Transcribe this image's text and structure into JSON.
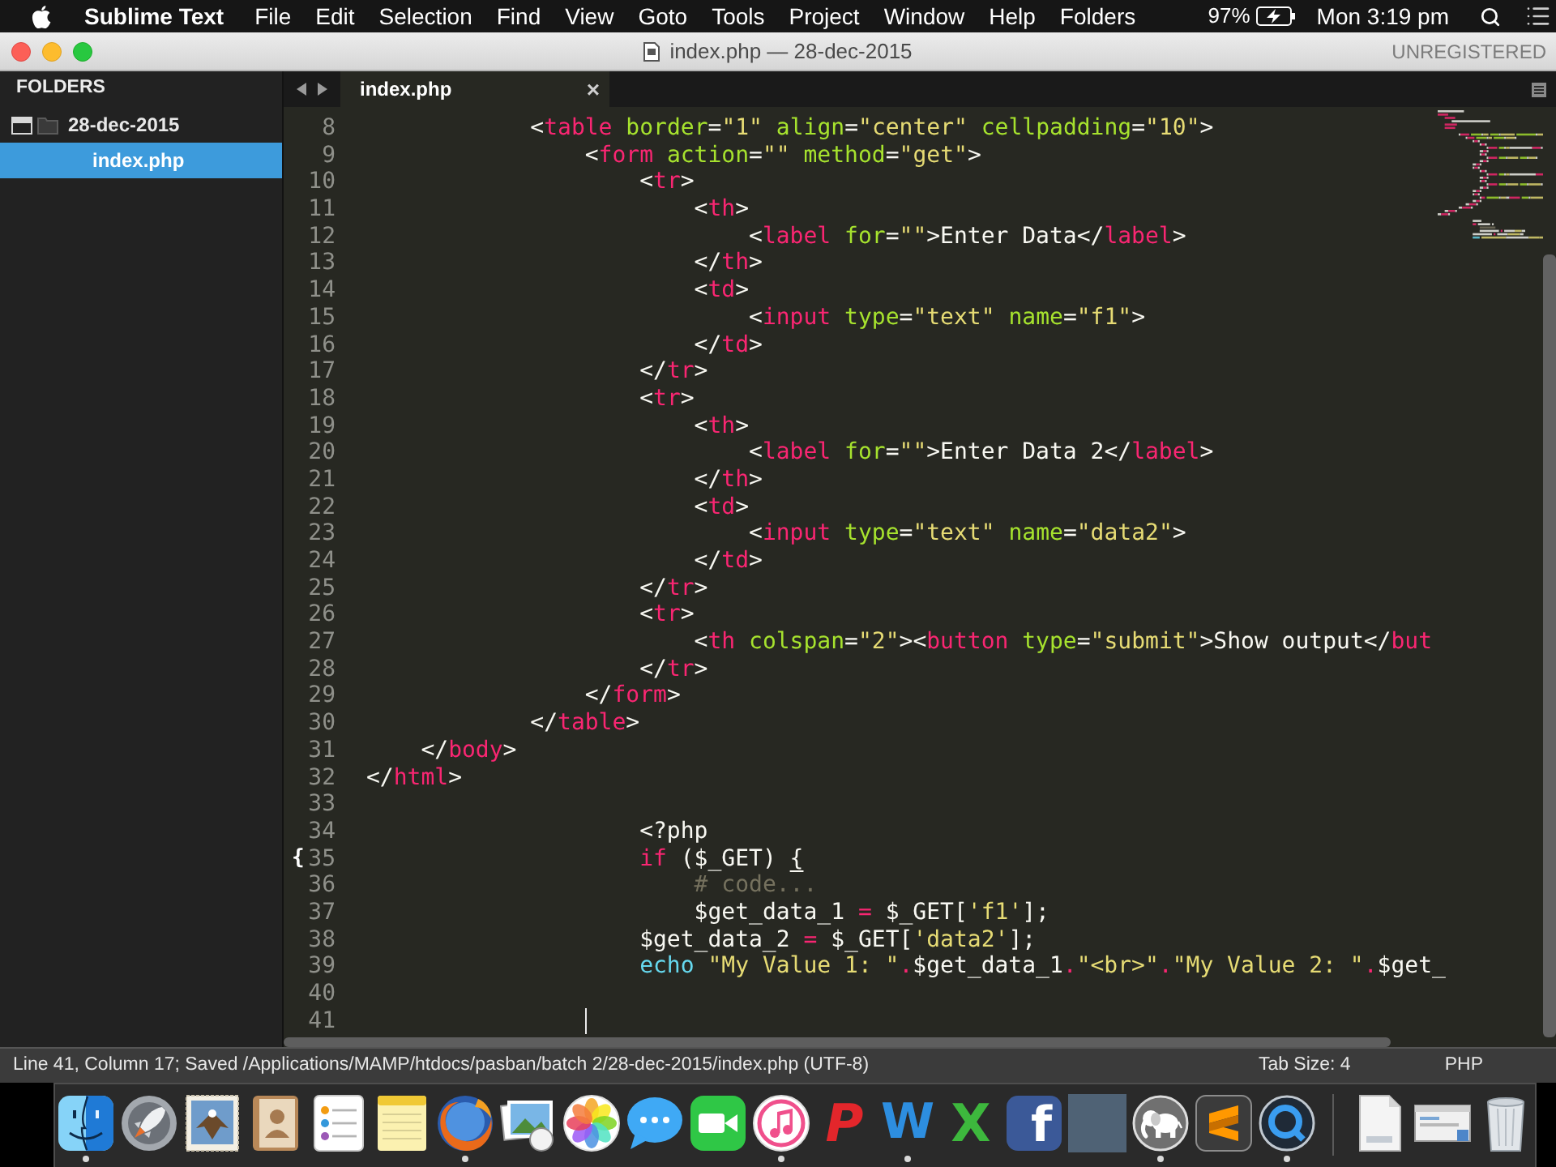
{
  "menu_bar": {
    "app_name": "Sublime Text",
    "menus": [
      "File",
      "Edit",
      "Selection",
      "Find",
      "View",
      "Goto",
      "Tools",
      "Project",
      "Window",
      "Help",
      "Folders"
    ],
    "battery": "97%",
    "clock": "Mon 3:19 pm"
  },
  "window": {
    "title": "index.php — 28-dec-2015",
    "registration": "UNREGISTERED"
  },
  "sidebar": {
    "heading": "FOLDERS",
    "items": [
      {
        "name": "28-dec-2015",
        "expanded": true,
        "selected": false,
        "children": [
          {
            "name": "index.php",
            "selected": true
          }
        ]
      }
    ]
  },
  "tabs": [
    {
      "label": "index.php",
      "selected": true,
      "close": "×"
    }
  ],
  "editor": {
    "lines": [
      {
        "number": "8",
        "cursor": false,
        "tokens": [
          {
            "kind": "plain",
            "text": "            <"
          },
          {
            "kind": "tag",
            "text": "table"
          },
          {
            "kind": "attr",
            "text": " border"
          },
          {
            "kind": "plain",
            "text": "="
          },
          {
            "kind": "string",
            "text": "\"1\""
          },
          {
            "kind": "attr",
            "text": " align"
          },
          {
            "kind": "plain",
            "text": "="
          },
          {
            "kind": "string",
            "text": "\"center\""
          },
          {
            "kind": "attr",
            "text": " cellpadding"
          },
          {
            "kind": "plain",
            "text": "="
          },
          {
            "kind": "string",
            "text": "\"10\""
          },
          {
            "kind": "plain",
            "text": ">"
          }
        ]
      },
      {
        "number": "9",
        "cursor": false,
        "tokens": [
          {
            "kind": "plain",
            "text": "                <"
          },
          {
            "kind": "tag",
            "text": "form"
          },
          {
            "kind": "attr",
            "text": " action"
          },
          {
            "kind": "plain",
            "text": "="
          },
          {
            "kind": "string",
            "text": "\"\""
          },
          {
            "kind": "attr",
            "text": " method"
          },
          {
            "kind": "plain",
            "text": "="
          },
          {
            "kind": "string",
            "text": "\"get\""
          },
          {
            "kind": "plain",
            "text": ">"
          }
        ]
      },
      {
        "number": "10",
        "cursor": false,
        "tokens": [
          {
            "kind": "plain",
            "text": "                    <"
          },
          {
            "kind": "tag",
            "text": "tr"
          },
          {
            "kind": "plain",
            "text": ">"
          }
        ]
      },
      {
        "number": "11",
        "cursor": false,
        "tokens": [
          {
            "kind": "plain",
            "text": "                        <"
          },
          {
            "kind": "tag",
            "text": "th"
          },
          {
            "kind": "plain",
            "text": ">"
          }
        ]
      },
      {
        "number": "12",
        "cursor": false,
        "tokens": [
          {
            "kind": "plain",
            "text": "                            <"
          },
          {
            "kind": "tag",
            "text": "label"
          },
          {
            "kind": "attr",
            "text": " for"
          },
          {
            "kind": "plain",
            "text": "="
          },
          {
            "kind": "string",
            "text": "\"\""
          },
          {
            "kind": "plain",
            "text": ">Enter Data</"
          },
          {
            "kind": "tag",
            "text": "label"
          },
          {
            "kind": "plain",
            "text": ">"
          }
        ]
      },
      {
        "number": "13",
        "cursor": false,
        "tokens": [
          {
            "kind": "plain",
            "text": "                        </"
          },
          {
            "kind": "tag",
            "text": "th"
          },
          {
            "kind": "plain",
            "text": ">"
          }
        ]
      },
      {
        "number": "14",
        "cursor": false,
        "tokens": [
          {
            "kind": "plain",
            "text": "                        <"
          },
          {
            "kind": "tag",
            "text": "td"
          },
          {
            "kind": "plain",
            "text": ">"
          }
        ]
      },
      {
        "number": "15",
        "cursor": false,
        "tokens": [
          {
            "kind": "plain",
            "text": "                            <"
          },
          {
            "kind": "tag",
            "text": "input"
          },
          {
            "kind": "attr",
            "text": " type"
          },
          {
            "kind": "plain",
            "text": "="
          },
          {
            "kind": "string",
            "text": "\"text\""
          },
          {
            "kind": "attr",
            "text": " name"
          },
          {
            "kind": "plain",
            "text": "="
          },
          {
            "kind": "string",
            "text": "\"f1\""
          },
          {
            "kind": "plain",
            "text": ">"
          }
        ]
      },
      {
        "number": "16",
        "cursor": false,
        "tokens": [
          {
            "kind": "plain",
            "text": "                        </"
          },
          {
            "kind": "tag",
            "text": "td"
          },
          {
            "kind": "plain",
            "text": ">"
          }
        ]
      },
      {
        "number": "17",
        "cursor": false,
        "tokens": [
          {
            "kind": "plain",
            "text": "                    </"
          },
          {
            "kind": "tag",
            "text": "tr"
          },
          {
            "kind": "plain",
            "text": ">"
          }
        ]
      },
      {
        "number": "18",
        "cursor": false,
        "tokens": [
          {
            "kind": "plain",
            "text": "                    <"
          },
          {
            "kind": "tag",
            "text": "tr"
          },
          {
            "kind": "plain",
            "text": ">"
          }
        ]
      },
      {
        "number": "19",
        "cursor": false,
        "tokens": [
          {
            "kind": "plain",
            "text": "                        <"
          },
          {
            "kind": "tag",
            "text": "th"
          },
          {
            "kind": "plain",
            "text": ">"
          }
        ]
      },
      {
        "number": "20",
        "cursor": false,
        "tokens": [
          {
            "kind": "plain",
            "text": "                            <"
          },
          {
            "kind": "tag",
            "text": "label"
          },
          {
            "kind": "attr",
            "text": " for"
          },
          {
            "kind": "plain",
            "text": "="
          },
          {
            "kind": "string",
            "text": "\"\""
          },
          {
            "kind": "plain",
            "text": ">Enter Data 2</"
          },
          {
            "kind": "tag",
            "text": "label"
          },
          {
            "kind": "plain",
            "text": ">"
          }
        ]
      },
      {
        "number": "21",
        "cursor": false,
        "tokens": [
          {
            "kind": "plain",
            "text": "                        </"
          },
          {
            "kind": "tag",
            "text": "th"
          },
          {
            "kind": "plain",
            "text": ">"
          }
        ]
      },
      {
        "number": "22",
        "cursor": false,
        "tokens": [
          {
            "kind": "plain",
            "text": "                        <"
          },
          {
            "kind": "tag",
            "text": "td"
          },
          {
            "kind": "plain",
            "text": ">"
          }
        ]
      },
      {
        "number": "23",
        "cursor": false,
        "tokens": [
          {
            "kind": "plain",
            "text": "                            <"
          },
          {
            "kind": "tag",
            "text": "input"
          },
          {
            "kind": "attr",
            "text": " type"
          },
          {
            "kind": "plain",
            "text": "="
          },
          {
            "kind": "string",
            "text": "\"text\""
          },
          {
            "kind": "attr",
            "text": " name"
          },
          {
            "kind": "plain",
            "text": "="
          },
          {
            "kind": "string",
            "text": "\"data2\""
          },
          {
            "kind": "plain",
            "text": ">"
          }
        ]
      },
      {
        "number": "24",
        "cursor": false,
        "tokens": [
          {
            "kind": "plain",
            "text": "                        </"
          },
          {
            "kind": "tag",
            "text": "td"
          },
          {
            "kind": "plain",
            "text": ">"
          }
        ]
      },
      {
        "number": "25",
        "cursor": false,
        "tokens": [
          {
            "kind": "plain",
            "text": "                    </"
          },
          {
            "kind": "tag",
            "text": "tr"
          },
          {
            "kind": "plain",
            "text": ">"
          }
        ]
      },
      {
        "number": "26",
        "cursor": false,
        "tokens": [
          {
            "kind": "plain",
            "text": "                    <"
          },
          {
            "kind": "tag",
            "text": "tr"
          },
          {
            "kind": "plain",
            "text": ">"
          }
        ]
      },
      {
        "number": "27",
        "cursor": false,
        "tokens": [
          {
            "kind": "plain",
            "text": "                        <"
          },
          {
            "kind": "tag",
            "text": "th"
          },
          {
            "kind": "attr",
            "text": " colspan"
          },
          {
            "kind": "plain",
            "text": "="
          },
          {
            "kind": "string",
            "text": "\"2\""
          },
          {
            "kind": "plain",
            "text": "><"
          },
          {
            "kind": "tag",
            "text": "button"
          },
          {
            "kind": "attr",
            "text": " type"
          },
          {
            "kind": "plain",
            "text": "="
          },
          {
            "kind": "string",
            "text": "\"submit\""
          },
          {
            "kind": "plain",
            "text": ">Show output</"
          },
          {
            "kind": "tag",
            "text": "but"
          }
        ]
      },
      {
        "number": "28",
        "cursor": false,
        "tokens": [
          {
            "kind": "plain",
            "text": "                    </"
          },
          {
            "kind": "tag",
            "text": "tr"
          },
          {
            "kind": "plain",
            "text": ">"
          }
        ]
      },
      {
        "number": "29",
        "cursor": false,
        "tokens": [
          {
            "kind": "plain",
            "text": "                </"
          },
          {
            "kind": "tag",
            "text": "form"
          },
          {
            "kind": "plain",
            "text": ">"
          }
        ]
      },
      {
        "number": "30",
        "cursor": false,
        "tokens": [
          {
            "kind": "plain",
            "text": "            </"
          },
          {
            "kind": "tag",
            "text": "table"
          },
          {
            "kind": "plain",
            "text": ">"
          }
        ]
      },
      {
        "number": "31",
        "cursor": false,
        "tokens": [
          {
            "kind": "plain",
            "text": "    </"
          },
          {
            "kind": "tag",
            "text": "body"
          },
          {
            "kind": "plain",
            "text": ">"
          }
        ]
      },
      {
        "number": "32",
        "cursor": false,
        "tokens": [
          {
            "kind": "plain",
            "text": "</"
          },
          {
            "kind": "tag",
            "text": "html"
          },
          {
            "kind": "plain",
            "text": ">"
          }
        ]
      },
      {
        "number": "33",
        "cursor": false
      },
      {
        "number": "34",
        "cursor": false,
        "tokens": [
          {
            "kind": "plain",
            "text": "                    <?php"
          }
        ]
      },
      {
        "number": "35",
        "cursor": false,
        "gutter_mark": "{",
        "tokens": [
          {
            "kind": "keyword",
            "text": "                    if"
          },
          {
            "kind": "plain",
            "text": " ($_GET) "
          },
          {
            "kind": "bracket",
            "text": "{"
          }
        ]
      },
      {
        "number": "36",
        "cursor": false,
        "tokens": [
          {
            "kind": "comment",
            "text": "                        # code..."
          }
        ]
      },
      {
        "number": "37",
        "cursor": false,
        "tokens": [
          {
            "kind": "plain",
            "text": "                        $get_data_1 "
          },
          {
            "kind": "operator",
            "text": "="
          },
          {
            "kind": "plain",
            "text": " $_GET["
          },
          {
            "kind": "string",
            "text": "'f1'"
          },
          {
            "kind": "plain",
            "text": "];"
          }
        ]
      },
      {
        "number": "38",
        "cursor": false,
        "tokens": [
          {
            "kind": "plain",
            "text": "                    $get_data_2 "
          },
          {
            "kind": "operator",
            "text": "="
          },
          {
            "kind": "plain",
            "text": " $_GET["
          },
          {
            "kind": "string",
            "text": "'data2'"
          },
          {
            "kind": "plain",
            "text": "];"
          }
        ]
      },
      {
        "number": "39",
        "cursor": false,
        "tokens": [
          {
            "kind": "builtin",
            "text": "                    echo"
          },
          {
            "kind": "string",
            "text": " \"My Value 1: \""
          },
          {
            "kind": "concat",
            "text": ".$get_data_1."
          },
          {
            "kind": "string",
            "text": "\"<br>\""
          },
          {
            "kind": "concat_string",
            "text": ".\"My Value 2: \"."
          },
          {
            "kind": "plain",
            "text": "$get_"
          }
        ]
      },
      {
        "number": "40",
        "cursor": false
      },
      {
        "number": "41",
        "cursor": true
      }
    ]
  },
  "status_bar": {
    "message": "Line 41, Column 17; Saved /Applications/MAMP/htdocs/pasban/batch 2/28-dec-2015/index.php (UTF-8)",
    "tab_size": "Tab Size: 4",
    "syntax": "PHP"
  },
  "dock": {
    "apps": [
      {
        "kind": "finder",
        "running": true
      },
      {
        "kind": "launcher",
        "running": false
      },
      {
        "kind": "mail",
        "running": false
      },
      {
        "kind": "contacts",
        "running": false
      },
      {
        "kind": "reminders",
        "running": false
      },
      {
        "kind": "notes",
        "running": false
      },
      {
        "kind": "browser",
        "running": true
      },
      {
        "kind": "preview",
        "running": false
      },
      {
        "kind": "photos",
        "running": false
      },
      {
        "kind": "messages",
        "running": false
      },
      {
        "kind": "facetime",
        "running": false
      },
      {
        "kind": "music",
        "running": true
      },
      {
        "kind": "presentation",
        "glyph": "P",
        "running": false
      },
      {
        "kind": "writer",
        "glyph": "W",
        "running": true
      },
      {
        "kind": "spreadsheet",
        "glyph": "X",
        "running": false
      },
      {
        "kind": "social",
        "glyph": "f",
        "running": false
      },
      {
        "kind": "photo",
        "running": false
      },
      {
        "kind": "server",
        "running": true
      },
      {
        "kind": "editor",
        "running": false
      },
      {
        "kind": "player",
        "running": true
      }
    ],
    "documents": [
      {
        "kind": "document"
      },
      {
        "kind": "window"
      },
      {
        "kind": "trash"
      }
    ]
  }
}
